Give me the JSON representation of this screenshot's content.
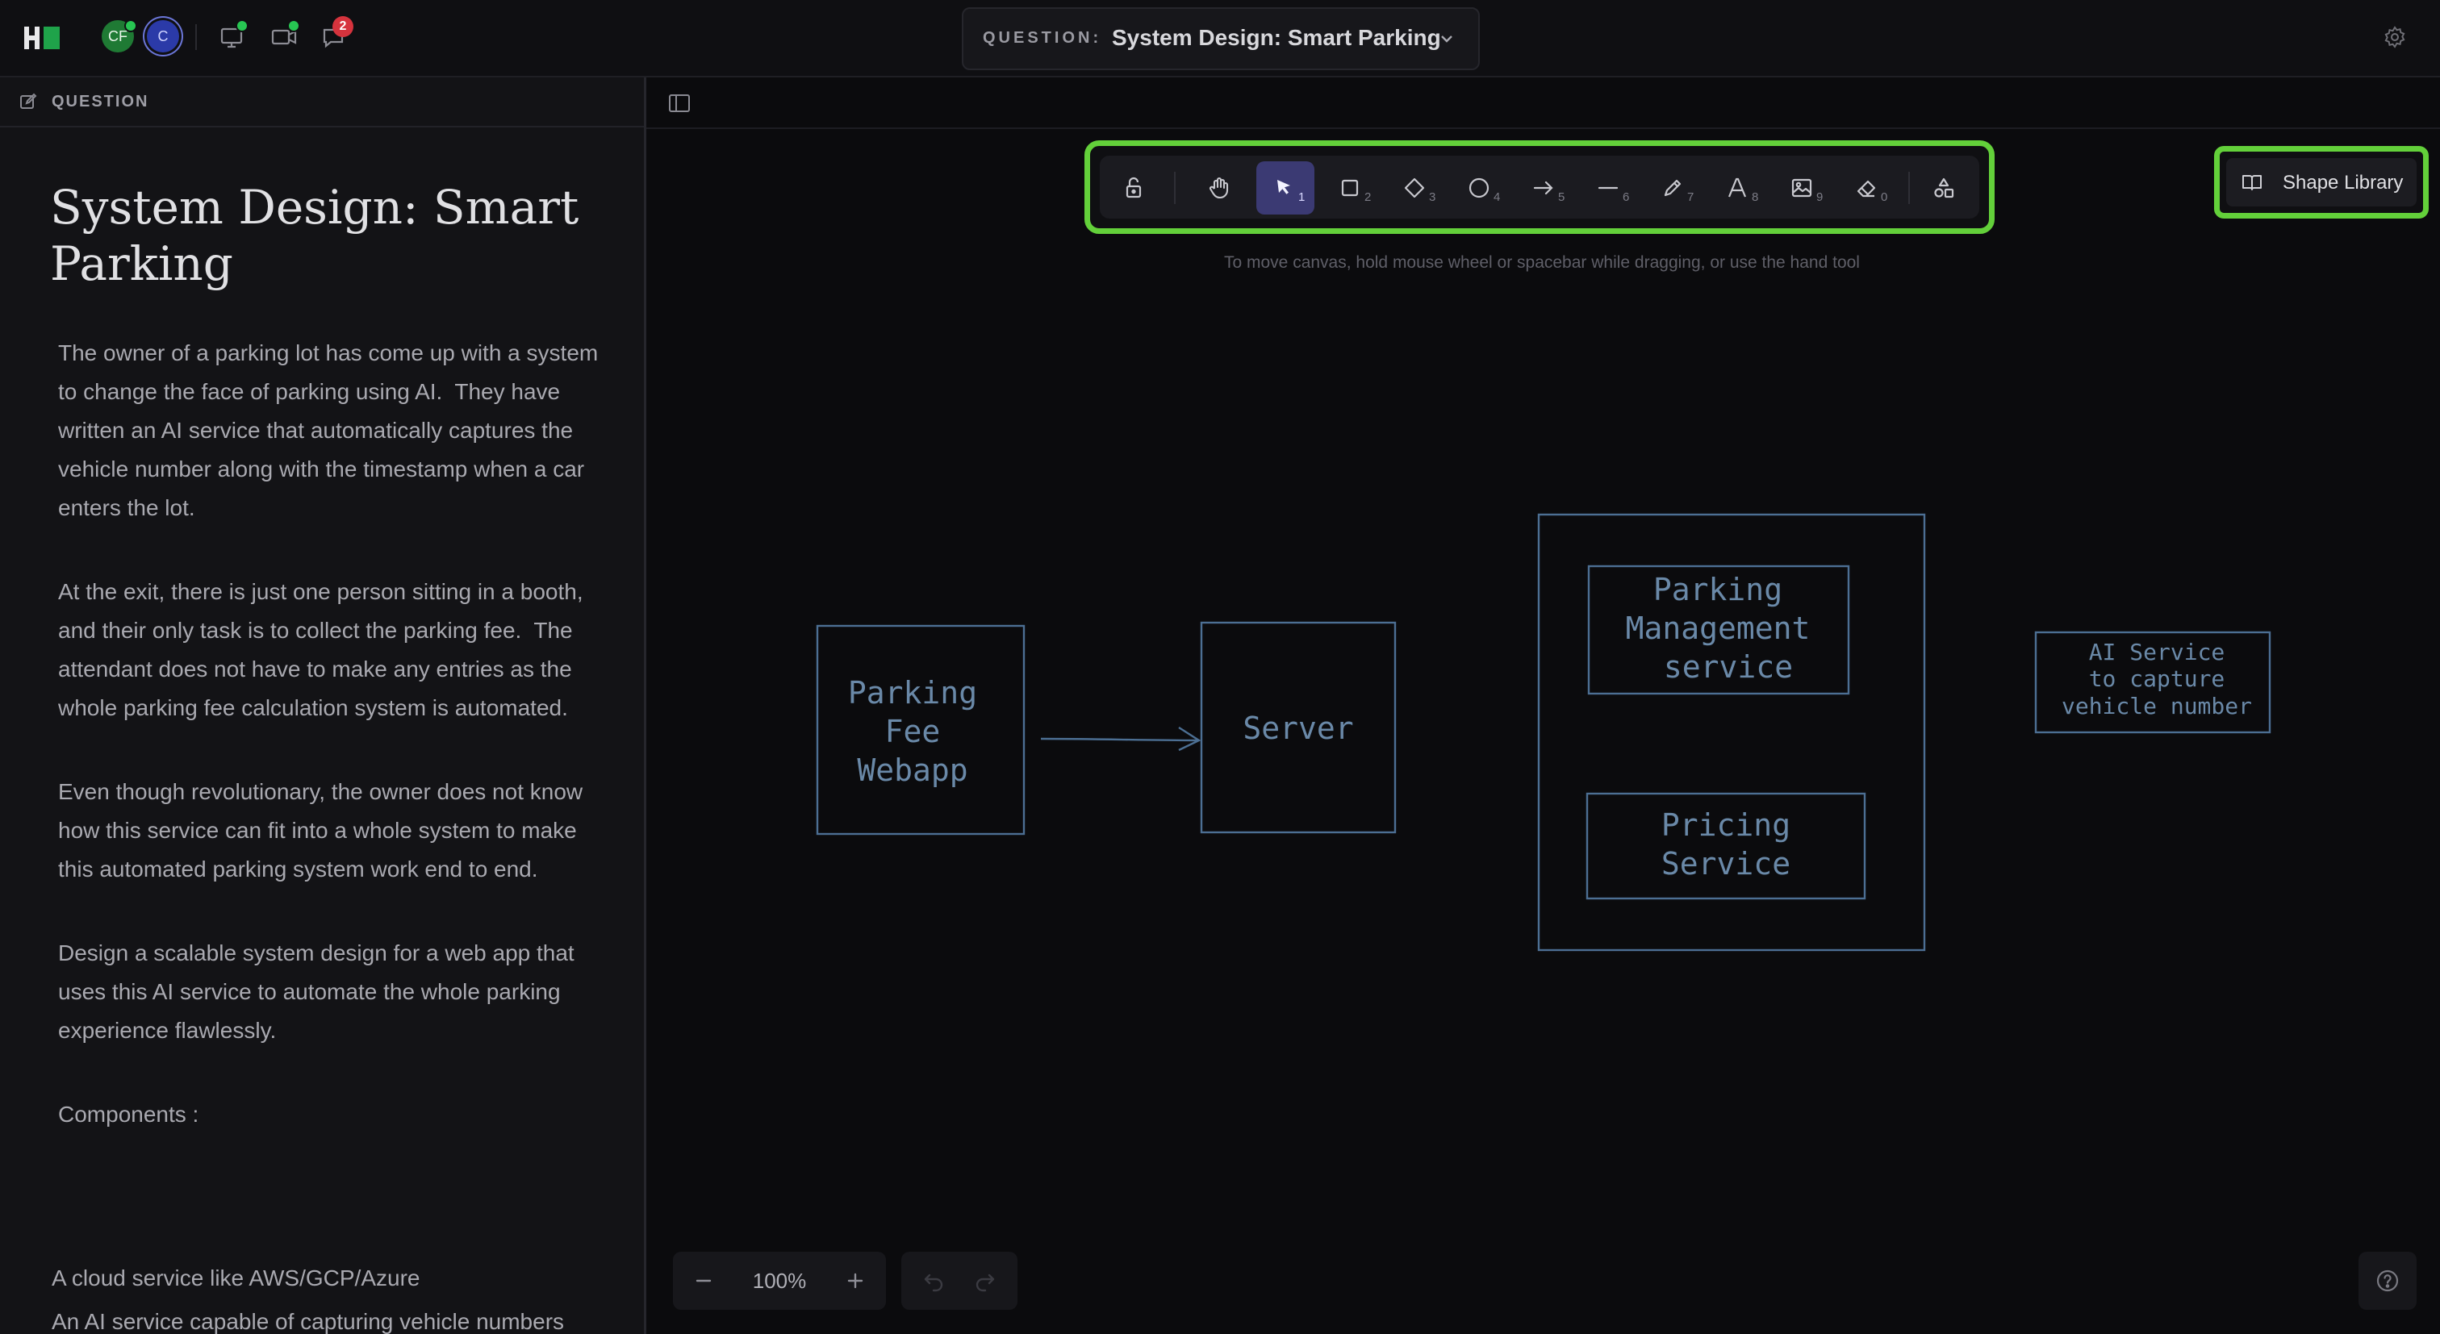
{
  "topbar": {
    "avatars": [
      "CF",
      "C"
    ],
    "notification_count": "2",
    "question_label": "QUESTION:",
    "question_title": "System Design: Smart Parking"
  },
  "left_panel": {
    "header": "QUESTION",
    "title": "System Design: Smart Parking",
    "paragraphs": [
      "The owner of a parking lot has come up with a system to change the face of parking using AI.  They have written an AI service that automatically captures the vehicle number along with the timestamp when a car enters the lot.",
      "At the exit, there is just one person sitting in a booth, and their only task is to collect the parking fee.  The attendant does not have to make any entries as the whole parking fee calculation system is automated.",
      "Even though revolutionary, the owner does not know how this service can fit into a whole system to make this automated parking system work end to end.",
      "Design a scalable system design for a web app that uses this AI service to automate the whole parking experience flawlessly.",
      "Components :"
    ],
    "components": [
      "A cloud service like AWS/GCP/Azure",
      "An AI service capable of capturing vehicle numbers"
    ]
  },
  "toolbar": {
    "tools": [
      {
        "name": "lock",
        "key": ""
      },
      {
        "name": "hand",
        "key": ""
      },
      {
        "name": "selection",
        "key": "1"
      },
      {
        "name": "rectangle",
        "key": "2"
      },
      {
        "name": "diamond",
        "key": "3"
      },
      {
        "name": "ellipse",
        "key": "4"
      },
      {
        "name": "arrow",
        "key": "5"
      },
      {
        "name": "line",
        "key": "6"
      },
      {
        "name": "draw",
        "key": "7"
      },
      {
        "name": "text",
        "key": "8"
      },
      {
        "name": "image",
        "key": "9"
      },
      {
        "name": "eraser",
        "key": "0"
      },
      {
        "name": "more-shapes",
        "key": ""
      }
    ],
    "active_tool": "selection",
    "accent_color": "#63d03a"
  },
  "canvas": {
    "hint": "To move canvas, hold mouse wheel or spacebar while dragging, or use the hand tool",
    "shape_library_label": "Shape Library",
    "zoom": "100%",
    "diagram": {
      "webapp": [
        "Parking",
        "Fee",
        "Webapp"
      ],
      "server": "Server",
      "parking_mgmt": [
        "Parking",
        "Management",
        "service"
      ],
      "pricing": [
        "Pricing",
        "Service"
      ],
      "ai_service": [
        "AI Service",
        "to capture",
        "vehicle number"
      ],
      "stroke_color": "#4c6f93"
    }
  }
}
